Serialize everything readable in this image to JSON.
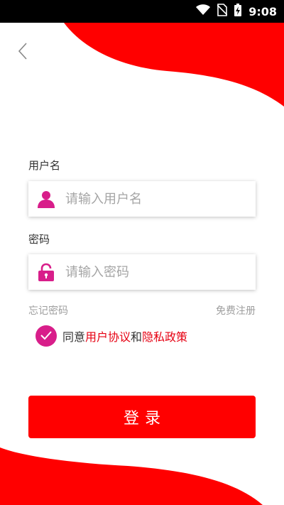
{
  "status_bar": {
    "time": "9:08",
    "icons": [
      "wifi-icon",
      "no-sim-icon",
      "battery-charging-icon"
    ]
  },
  "nav": {
    "back_icon": "chevron-left-icon"
  },
  "form": {
    "username_label": "用户名",
    "username_placeholder": "请输入用户名",
    "username_value": "",
    "username_icon": "user-icon",
    "password_label": "密码",
    "password_placeholder": "请输入密码",
    "password_value": "",
    "password_icon": "lock-icon",
    "forgot_password": "忘记密码",
    "register": "免费注册"
  },
  "agreement": {
    "checked": true,
    "prefix": "同意",
    "user_agreement": "用户协议",
    "conjunction": "和",
    "privacy_policy": "隐私政策"
  },
  "login_button": "登录",
  "colors": {
    "brand_red": "#ff0000",
    "accent_pink": "#d81e8a",
    "link_red": "#e60012",
    "placeholder_gray": "#a5a5a5"
  }
}
